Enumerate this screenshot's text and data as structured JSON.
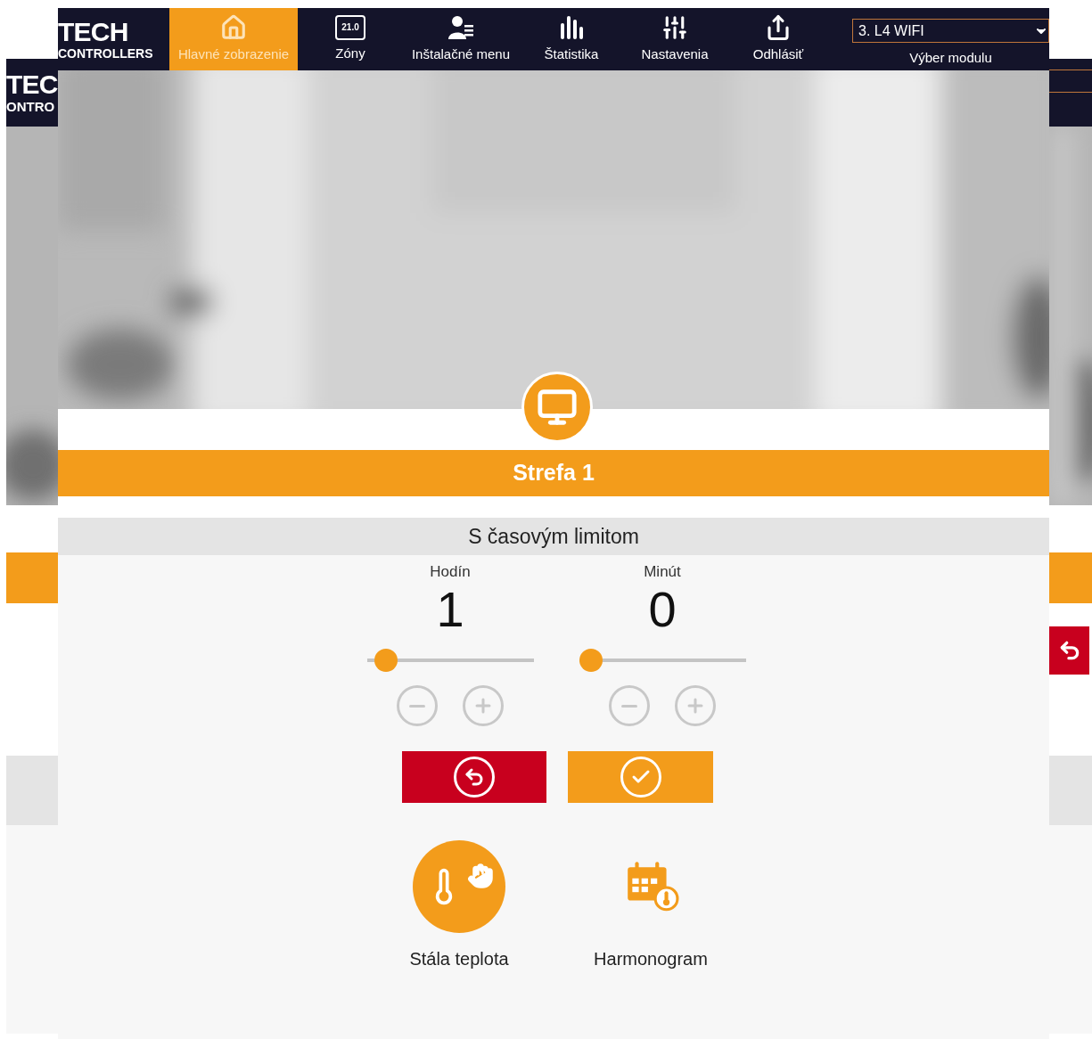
{
  "background_window": {
    "logo": {
      "title": "TEC",
      "subtitle": "ONTRO"
    }
  },
  "nav": {
    "logo": {
      "title": "TECH",
      "subtitle": "CONTROLLERS"
    },
    "items": [
      {
        "kind": "home",
        "label": "Hlavné zobrazenie",
        "selected": true
      },
      {
        "kind": "zones",
        "label": "Zóny",
        "badge": "21.0",
        "selected": false
      },
      {
        "kind": "installer",
        "label": "Inštalačné menu",
        "selected": false
      },
      {
        "kind": "stats",
        "label": "Štatistika",
        "selected": false
      },
      {
        "kind": "settings",
        "label": "Nastavenia",
        "selected": false
      },
      {
        "kind": "logout",
        "label": "Odhlásiť",
        "selected": false
      }
    ],
    "module_select": {
      "value": "3. L4 WIFI",
      "label": "Výber modulu"
    }
  },
  "zone": {
    "title": "Strefa 1",
    "mode_title": "S časovým limitom",
    "timers": [
      {
        "label": "Hodín",
        "value": "1",
        "level": 0.05
      },
      {
        "label": "Minút",
        "value": "0",
        "level": 0
      }
    ]
  },
  "modes": [
    {
      "kind": "constant",
      "label": "Stála teplota",
      "selected": true
    },
    {
      "kind": "schedule",
      "label": "Harmonogram",
      "selected": false
    }
  ]
}
